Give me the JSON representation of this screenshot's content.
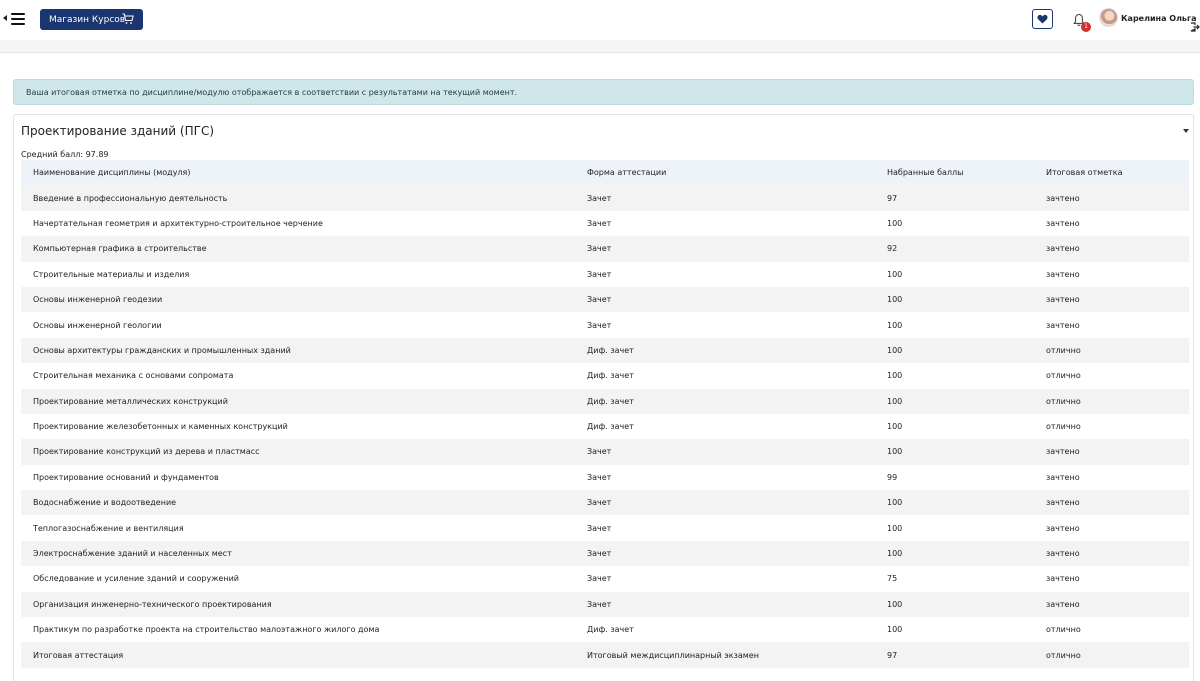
{
  "header": {
    "shop_label": "Магазин Курсов",
    "notification_count": "1",
    "user_name": "Карелина Ольга"
  },
  "alert": {
    "text": "Ваша итоговая отметка по дисциплине/модулю отображается в соответствии с результатами на текущий момент."
  },
  "card": {
    "title": "Проектирование зданий (ПГС)",
    "average_label": "Средний балл: 97.89"
  },
  "table": {
    "columns": [
      "Наименование дисциплины (модуля)",
      "Форма аттестации",
      "Набранные баллы",
      "Итоговая отметка"
    ],
    "rows": [
      [
        "Введение в профессиональную деятельность",
        "Зачет",
        "97",
        "зачтено"
      ],
      [
        "Начертательная геометрия и архитектурно-строительное черчение",
        "Зачет",
        "100",
        "зачтено"
      ],
      [
        "Компьютерная графика в строительстве",
        "Зачет",
        "92",
        "зачтено"
      ],
      [
        "Строительные материалы и изделия",
        "Зачет",
        "100",
        "зачтено"
      ],
      [
        "Основы инженерной геодезии",
        "Зачет",
        "100",
        "зачтено"
      ],
      [
        "Основы инженерной геологии",
        "Зачет",
        "100",
        "зачтено"
      ],
      [
        "Основы архитектуры гражданских и промышленных зданий",
        "Диф. зачет",
        "100",
        "отлично"
      ],
      [
        "Строительная механика с основами сопромата",
        "Диф. зачет",
        "100",
        "отлично"
      ],
      [
        "Проектирование металлических конструкций",
        "Диф. зачет",
        "100",
        "отлично"
      ],
      [
        "Проектирование железобетонных и каменных конструкций",
        "Диф. зачет",
        "100",
        "отлично"
      ],
      [
        "Проектирование конструкций из дерева и пластмасс",
        "Зачет",
        "100",
        "зачтено"
      ],
      [
        "Проектирование оснований и фундаментов",
        "Зачет",
        "99",
        "зачтено"
      ],
      [
        "Водоснабжение и водоотведение",
        "Зачет",
        "100",
        "зачтено"
      ],
      [
        "Теплогазоснабжение и вентиляция",
        "Зачет",
        "100",
        "зачтено"
      ],
      [
        "Электроснабжение зданий и населенных мест",
        "Зачет",
        "100",
        "зачтено"
      ],
      [
        "Обследование и усиление зданий и сооружений",
        "Зачет",
        "75",
        "зачтено"
      ],
      [
        "Организация инженерно-технического проектирования",
        "Зачет",
        "100",
        "зачтено"
      ],
      [
        "Практикум по разработке проекта на строительство малоэтажного жилого дома",
        "Диф. зачет",
        "100",
        "отлично"
      ],
      [
        "Итоговая аттестация",
        "Итоговый междисциплинарный экзамен",
        "97",
        "отлично"
      ]
    ]
  },
  "colors": {
    "brand": "#1a3570",
    "alert_bg": "#cfe6ea",
    "header_row_bg": "#eef3f9",
    "badge": "#d32f2f"
  },
  "icons": [
    "menu-icon",
    "cart-icon",
    "heart-icon",
    "bell-icon",
    "avatar",
    "logout-icon",
    "chevron-down-icon"
  ]
}
